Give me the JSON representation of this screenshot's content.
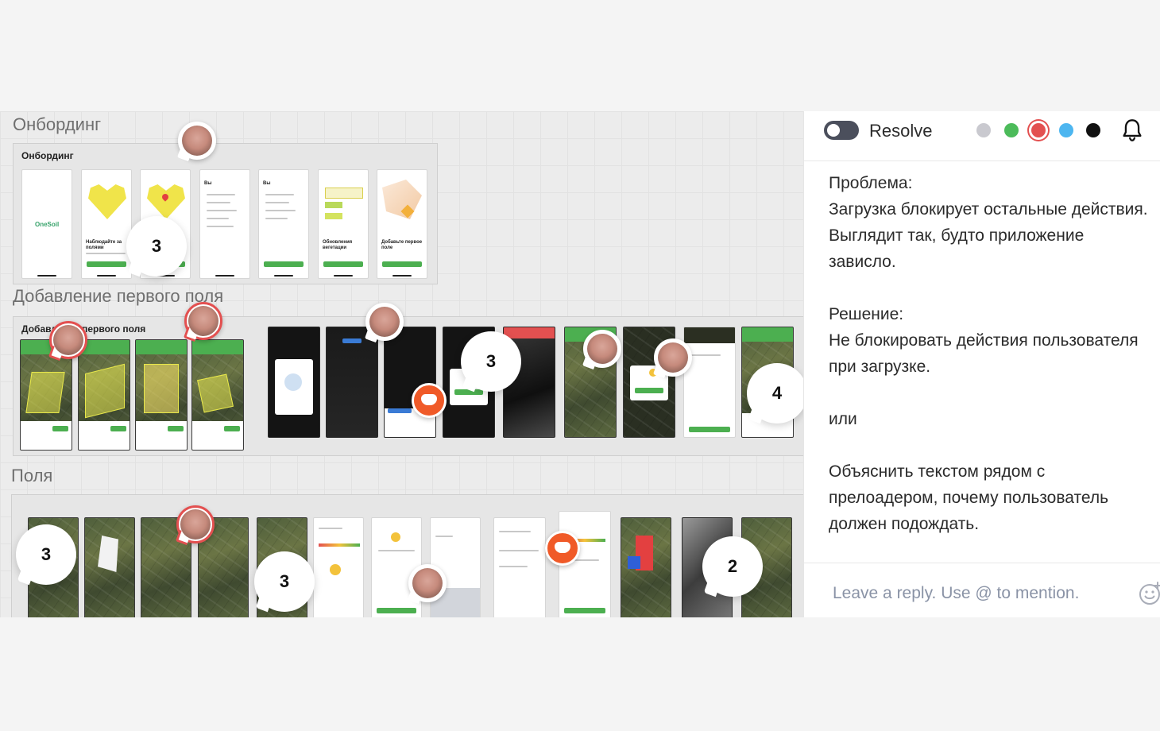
{
  "canvas": {
    "sections": [
      {
        "title": "Онбординг",
        "frame_title": "Онбординг"
      },
      {
        "title": "Добавление первого поля",
        "frame_title": "Добавление первого поля"
      },
      {
        "title": "Поля",
        "frame_title": ""
      }
    ],
    "onboarding_screens": {
      "logo": "OneSoil",
      "caption_2": "Наблюдайте за полями",
      "caption_6": "Обновления вегетации",
      "caption_7": "Добавьте первое поле",
      "header_4": "Вы",
      "header_5": "Вы"
    },
    "pins": {
      "bubble_counts": [
        "3",
        "3",
        "4",
        "3",
        "3",
        "2"
      ]
    }
  },
  "panel": {
    "resolve_label": "Resolve",
    "resolve_on": false,
    "colors": [
      "#c9c9cf",
      "#4cbb5a",
      "#e35050",
      "#4db6f0",
      "#111111"
    ],
    "selected_color": "#e35050",
    "icons": {
      "bell": "bell-icon",
      "emoji": "emoji-add-icon"
    },
    "comment": {
      "problem_heading": "Проблема:",
      "problem_text": "Загрузка блокирует остальные действия. Выглядит так, будто приложение зависло.",
      "solution_heading": "Решение:",
      "solution_text": "Не блокировать действия пользователя при загрузке.",
      "or": "или",
      "alt_text": "Объяснить текстом рядом с прелоадером, почему пользователь должен подождать."
    },
    "reply_placeholder": "Leave a reply. Use @ to mention."
  }
}
